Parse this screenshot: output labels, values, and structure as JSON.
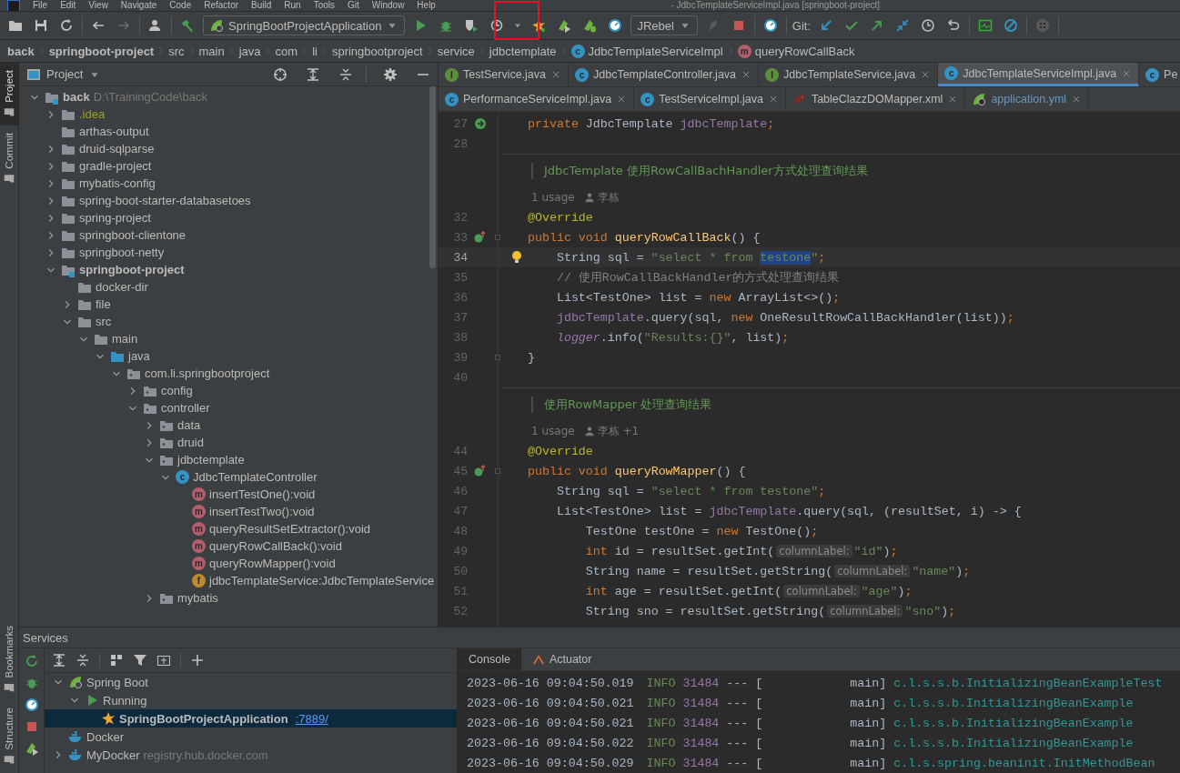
{
  "menu": [
    "File",
    "Edit",
    "View",
    "Navigate",
    "Code",
    "Refactor",
    "Build",
    "Run",
    "Tools",
    "Git",
    "Window",
    "Help"
  ],
  "window": {
    "title": "- JdbcTemplateServiceImpl.java [springboot-project]"
  },
  "toolbar": {
    "run_config": "SpringBootProjectApplication",
    "jrebel_config": "JRebel",
    "git_label": "Git:"
  },
  "breadcrumbs": [
    {
      "label": "back",
      "kind": "module"
    },
    {
      "label": "springboot-project",
      "kind": "module"
    },
    {
      "label": "src",
      "kind": "plain"
    },
    {
      "label": "main",
      "kind": "plain"
    },
    {
      "label": "java",
      "kind": "plain"
    },
    {
      "label": "com",
      "kind": "plain"
    },
    {
      "label": "li",
      "kind": "plain"
    },
    {
      "label": "springbootproject",
      "kind": "plain"
    },
    {
      "label": "service",
      "kind": "plain"
    },
    {
      "label": "jdbctemplate",
      "kind": "plain"
    },
    {
      "label": "JdbcTemplateServiceImpl",
      "kind": "class",
      "badge": "c"
    },
    {
      "label": "queryRowCallBack",
      "kind": "method",
      "badge": "m"
    }
  ],
  "side_tabs_top": [
    {
      "label": "Project",
      "selected": true
    },
    {
      "label": "Commit",
      "selected": false
    }
  ],
  "side_tabs_bottom": [
    {
      "label": "Bookmarks",
      "selected": false
    },
    {
      "label": "Structure",
      "selected": false
    }
  ],
  "project_panel": {
    "title": "Project",
    "tree": [
      {
        "label": "back",
        "kind": "module",
        "hint": "D:\\TrainingCode\\back",
        "expanded": true,
        "children": [
          {
            "label": ".idea",
            "kind": "config_folder",
            "expanded": false
          },
          {
            "label": "arthas-output",
            "kind": "folder"
          },
          {
            "label": "druid-sqlparse",
            "kind": "folder",
            "expanded": false
          },
          {
            "label": "gradle-project",
            "kind": "folder",
            "expanded": false
          },
          {
            "label": "mybatis-config",
            "kind": "folder",
            "expanded": false
          },
          {
            "label": "spring-boot-starter-databasetoes",
            "kind": "folder",
            "expanded": false
          },
          {
            "label": "spring-project",
            "kind": "folder",
            "expanded": false
          },
          {
            "label": "springboot-clientone",
            "kind": "folder",
            "expanded": false
          },
          {
            "label": "springboot-netty",
            "kind": "folder",
            "expanded": false
          },
          {
            "label": "springboot-project",
            "kind": "module",
            "expanded": true,
            "children": [
              {
                "label": "docker-dir",
                "kind": "folder"
              },
              {
                "label": "file",
                "kind": "folder",
                "expanded": false
              },
              {
                "label": "src",
                "kind": "folder",
                "expanded": true,
                "children": [
                  {
                    "label": "main",
                    "kind": "folder",
                    "expanded": true,
                    "children": [
                      {
                        "label": "java",
                        "kind": "source_folder",
                        "expanded": true,
                        "children": [
                          {
                            "label": "com.li.springbootproject",
                            "kind": "package",
                            "expanded": true,
                            "children": [
                              {
                                "label": "config",
                                "kind": "package",
                                "expanded": false
                              },
                              {
                                "label": "controller",
                                "kind": "package",
                                "expanded": true,
                                "children": [
                                  {
                                    "label": "data",
                                    "kind": "package",
                                    "expanded": false
                                  },
                                  {
                                    "label": "druid",
                                    "kind": "package",
                                    "expanded": false
                                  },
                                  {
                                    "label": "jdbctemplate",
                                    "kind": "package",
                                    "expanded": true,
                                    "children": [
                                      {
                                        "label": "JdbcTemplateController",
                                        "kind": "class",
                                        "badge": "c",
                                        "expanded": true,
                                        "children": [
                                          {
                                            "label": "insertTestOne():void",
                                            "kind": "method",
                                            "badge": "m"
                                          },
                                          {
                                            "label": "insertTestTwo():void",
                                            "kind": "method",
                                            "badge": "m"
                                          },
                                          {
                                            "label": "queryResultSetExtractor():void",
                                            "kind": "method",
                                            "badge": "m"
                                          },
                                          {
                                            "label": "queryRowCallBack():void",
                                            "kind": "method",
                                            "badge": "m"
                                          },
                                          {
                                            "label": "queryRowMapper():void",
                                            "kind": "method",
                                            "badge": "m"
                                          },
                                          {
                                            "label": "jdbcTemplateService:JdbcTemplateService",
                                            "kind": "field",
                                            "badge": "f"
                                          }
                                        ]
                                      }
                                    ]
                                  },
                                  {
                                    "label": "mybatis",
                                    "kind": "package",
                                    "expanded": false
                                  }
                                ]
                              }
                            ]
                          }
                        ]
                      }
                    ]
                  }
                ]
              }
            ]
          }
        ]
      }
    ]
  },
  "editor": {
    "tab_rows": [
      [
        {
          "label": "TestService.java",
          "kind": "interface",
          "badge": "I",
          "selected": false,
          "modified": false,
          "closable": true
        },
        {
          "label": "JdbcTemplateController.java",
          "kind": "class",
          "badge": "c",
          "selected": false,
          "modified": false,
          "closable": true
        },
        {
          "label": "JdbcTemplateService.java",
          "kind": "interface",
          "badge": "I",
          "selected": false,
          "modified": false,
          "closable": true
        },
        {
          "label": "JdbcTemplateServiceImpl.java",
          "kind": "class",
          "badge": "c",
          "selected": true,
          "modified": false,
          "closable": true
        },
        {
          "label": "Pe",
          "kind": "class",
          "badge": "c",
          "selected": false,
          "modified": false,
          "closable": false
        }
      ],
      [
        {
          "label": "PerformanceServiceImpl.java",
          "kind": "class",
          "badge": "c",
          "selected": false,
          "modified": false,
          "closable": true
        },
        {
          "label": "TestServiceImpl.java",
          "kind": "class",
          "badge": "c",
          "selected": false,
          "modified": false,
          "closable": true
        },
        {
          "label": "TableClazzDOMapper.xml",
          "kind": "xml",
          "selected": false,
          "modified": false,
          "closable": true
        },
        {
          "label": "application.yml",
          "kind": "spring",
          "selected": false,
          "modified": true,
          "closable": true
        }
      ]
    ],
    "lines": [
      {
        "kind": "code",
        "number": "27",
        "gutter": {
          "kind": "bean"
        },
        "tokens": [
          {
            "t": "private",
            "kind": "kw"
          },
          {
            "t": " JdbcTemplate ",
            "kind": "plain"
          },
          {
            "t": "jdbcTemplate",
            "kind": "field"
          },
          {
            "t": ";",
            "kind": "kw"
          }
        ]
      },
      {
        "kind": "code",
        "number": "28"
      },
      {
        "kind": "doc",
        "text": "JdbcTemplate 使用RowCallBachHandler方式处理查询结果"
      },
      {
        "kind": "usage",
        "text": "1 usage",
        "author": "李栋"
      },
      {
        "kind": "code",
        "number": "32",
        "tokens": [
          {
            "t": "@Override",
            "kind": "annotation"
          }
        ]
      },
      {
        "kind": "code",
        "number": "33",
        "gutter": {
          "kind": "impl"
        },
        "fold": true,
        "tokens": [
          {
            "t": "public void ",
            "kind": "kw"
          },
          {
            "t": "queryRowCallBack",
            "kind": "fn"
          },
          {
            "t": "() {",
            "kind": "plain"
          }
        ]
      },
      {
        "kind": "code",
        "number": "34",
        "current": true,
        "bulb": true,
        "tokens": [
          {
            "t": "    String sql = ",
            "kind": "plain"
          },
          {
            "t": "\"select * from ",
            "kind": "str"
          },
          {
            "t": "testone",
            "kind": "strsel"
          },
          {
            "t": "\"",
            "kind": "str"
          },
          {
            "t": ";",
            "kind": "kw"
          }
        ]
      },
      {
        "kind": "code",
        "number": "35",
        "tokens": [
          {
            "t": "    // 使用RowCallBackHandler的方式处理查询结果",
            "kind": "comment"
          }
        ]
      },
      {
        "kind": "code",
        "number": "36",
        "tokens": [
          {
            "t": "    List<TestOne> list = ",
            "kind": "plain"
          },
          {
            "t": "new ",
            "kind": "kw"
          },
          {
            "t": "ArrayList<>()",
            "kind": "plain"
          },
          {
            "t": ";",
            "kind": "kw"
          }
        ]
      },
      {
        "kind": "code",
        "number": "37",
        "tokens": [
          {
            "t": "    jdbcTemplate",
            "kind": "field"
          },
          {
            "t": ".query(sql, ",
            "kind": "plain"
          },
          {
            "t": "new ",
            "kind": "kw"
          },
          {
            "t": "OneResultRowCallBackHandler(list))",
            "kind": "plain"
          },
          {
            "t": ";",
            "kind": "kw"
          }
        ]
      },
      {
        "kind": "code",
        "number": "38",
        "tokens": [
          {
            "t": "    logger",
            "kind": "static"
          },
          {
            "t": ".info(",
            "kind": "plain"
          },
          {
            "t": "\"Results:{}\"",
            "kind": "str"
          },
          {
            "t": ", list)",
            "kind": "plain"
          },
          {
            "t": ";",
            "kind": "kw"
          }
        ]
      },
      {
        "kind": "code",
        "number": "39",
        "fold": true,
        "tokens": [
          {
            "t": "}",
            "kind": "plain"
          }
        ]
      },
      {
        "kind": "code",
        "number": "40"
      },
      {
        "kind": "doc",
        "text": "使用RowMapper 处理查询结果"
      },
      {
        "kind": "usage",
        "text": "1 usage",
        "author": "李栋 +1"
      },
      {
        "kind": "code",
        "number": "44",
        "tokens": [
          {
            "t": "@Override",
            "kind": "annotation"
          }
        ]
      },
      {
        "kind": "code",
        "number": "45",
        "gutter": {
          "kind": "impl"
        },
        "fold": true,
        "tokens": [
          {
            "t": "public void ",
            "kind": "kw"
          },
          {
            "t": "queryRowMapper",
            "kind": "fn"
          },
          {
            "t": "() {",
            "kind": "plain"
          }
        ]
      },
      {
        "kind": "code",
        "number": "46",
        "tokens": [
          {
            "t": "    String sql = ",
            "kind": "plain"
          },
          {
            "t": "\"select * from testone\"",
            "kind": "str"
          },
          {
            "t": ";",
            "kind": "kw"
          }
        ]
      },
      {
        "kind": "code",
        "number": "47",
        "tokens": [
          {
            "t": "    List<TestOne> list = ",
            "kind": "plain"
          },
          {
            "t": "jdbcTemplate",
            "kind": "field"
          },
          {
            "t": ".query(sql, (resultSet, i) -> {",
            "kind": "plain"
          }
        ]
      },
      {
        "kind": "code",
        "number": "48",
        "tokens": [
          {
            "t": "        TestOne testOne = ",
            "kind": "plain"
          },
          {
            "t": "new ",
            "kind": "kw"
          },
          {
            "t": "TestOne()",
            "kind": "plain"
          },
          {
            "t": ";",
            "kind": "kw"
          }
        ]
      },
      {
        "kind": "code",
        "number": "49",
        "tokens": [
          {
            "t": "        int ",
            "kind": "kw"
          },
          {
            "t": "id = resultSet.getInt(",
            "kind": "plain"
          },
          {
            "t": "columnLabel:",
            "kind": "hint"
          },
          {
            "t": "\"id\"",
            "kind": "str"
          },
          {
            "t": ")",
            "kind": "plain"
          },
          {
            "t": ";",
            "kind": "kw"
          }
        ]
      },
      {
        "kind": "code",
        "number": "50",
        "tokens": [
          {
            "t": "        String name = resultSet.getString(",
            "kind": "plain"
          },
          {
            "t": "columnLabel:",
            "kind": "hint"
          },
          {
            "t": "\"name\"",
            "kind": "str"
          },
          {
            "t": ")",
            "kind": "plain"
          },
          {
            "t": ";",
            "kind": "kw"
          }
        ]
      },
      {
        "kind": "code",
        "number": "51",
        "tokens": [
          {
            "t": "        int ",
            "kind": "kw"
          },
          {
            "t": "age = resultSet.getInt(",
            "kind": "plain"
          },
          {
            "t": "columnLabel:",
            "kind": "hint"
          },
          {
            "t": "\"age\"",
            "kind": "str"
          },
          {
            "t": ")",
            "kind": "plain"
          },
          {
            "t": ";",
            "kind": "kw"
          }
        ]
      },
      {
        "kind": "code",
        "number": "52",
        "tokens": [
          {
            "t": "        String sno = resultSet.getString(",
            "kind": "plain"
          },
          {
            "t": "columnLabel:",
            "kind": "hint"
          },
          {
            "t": "\"sno\"",
            "kind": "str"
          },
          {
            "t": ")",
            "kind": "plain"
          },
          {
            "t": ";",
            "kind": "kw"
          }
        ]
      }
    ]
  },
  "services": {
    "title": "Services",
    "tree": [
      {
        "label": "Spring Boot",
        "kind": "spring",
        "expanded": true,
        "children": [
          {
            "label": "Running",
            "kind": "running",
            "expanded": true,
            "children": [
              {
                "label": "SpringBootProjectApplication",
                "kind": "app",
                "link": ":7889/",
                "selected": true
              }
            ]
          }
        ]
      },
      {
        "label": "Docker",
        "kind": "docker",
        "selected": false
      },
      {
        "label": "MyDocker",
        "kind": "docker",
        "hint": "registry.hub.docker.com",
        "expanded": false,
        "selected": false
      }
    ],
    "console_tabs": [
      {
        "label": "Console",
        "selected": true
      },
      {
        "label": "Actuator",
        "selected": false
      }
    ],
    "log": [
      {
        "time": "2023-06-16 09:04:50.019",
        "level": "INFO",
        "pid": "31484",
        "sep": "---",
        "bracket": "[",
        "thread": "main]",
        "logger": "c.l.s.s.b.InitializingBeanExampleTest"
      },
      {
        "time": "2023-06-16 09:04:50.021",
        "level": "INFO",
        "pid": "31484",
        "sep": "---",
        "bracket": "[",
        "thread": "main]",
        "logger": "c.l.s.s.b.InitializingBeanExample"
      },
      {
        "time": "2023-06-16 09:04:50.021",
        "level": "INFO",
        "pid": "31484",
        "sep": "---",
        "bracket": "[",
        "thread": "main]",
        "logger": "c.l.s.s.b.InitializingBeanExample"
      },
      {
        "time": "2023-06-16 09:04:50.022",
        "level": "INFO",
        "pid": "31484",
        "sep": "---",
        "bracket": "[",
        "thread": "main]",
        "logger": "c.l.s.s.b.InitializingBeanExample"
      },
      {
        "time": "2023-06-16 09:04:50.029",
        "level": "INFO",
        "pid": "31484",
        "sep": "---",
        "bracket": "[",
        "thread": "main]",
        "logger": "c.l.s.spring.beaninit.InitMethodBean"
      }
    ]
  }
}
